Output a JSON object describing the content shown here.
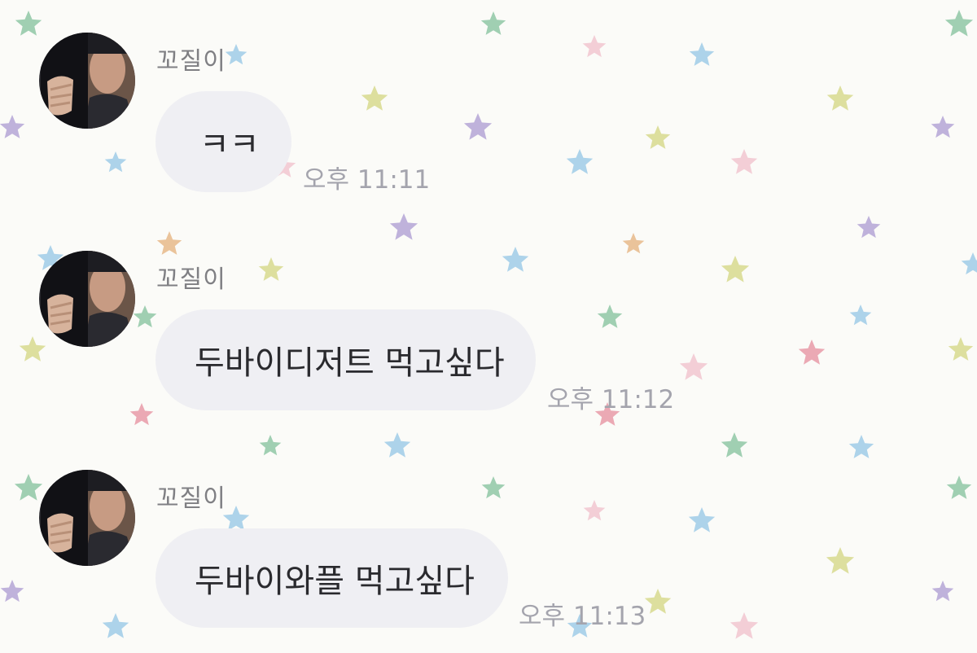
{
  "chat": {
    "messages": [
      {
        "sender": "꼬질이",
        "text": "ㅋㅋ",
        "time": "오후 11:11"
      },
      {
        "sender": "꼬질이",
        "text": "두바이디저트 먹고싶다",
        "time": "오후 11:12"
      },
      {
        "sender": "꼬질이",
        "text": "두바이와플 먹고싶다",
        "time": "오후 11:13"
      }
    ]
  },
  "theme": {
    "bubble_bg": "#efeff3",
    "background": "#fbfbf8",
    "star_colors": [
      "#8fc7a6",
      "#b4a5d6",
      "#9fcbe8",
      "#e6b98a",
      "#e79aa8",
      "#d7d98e",
      "#f1c6d0"
    ]
  }
}
